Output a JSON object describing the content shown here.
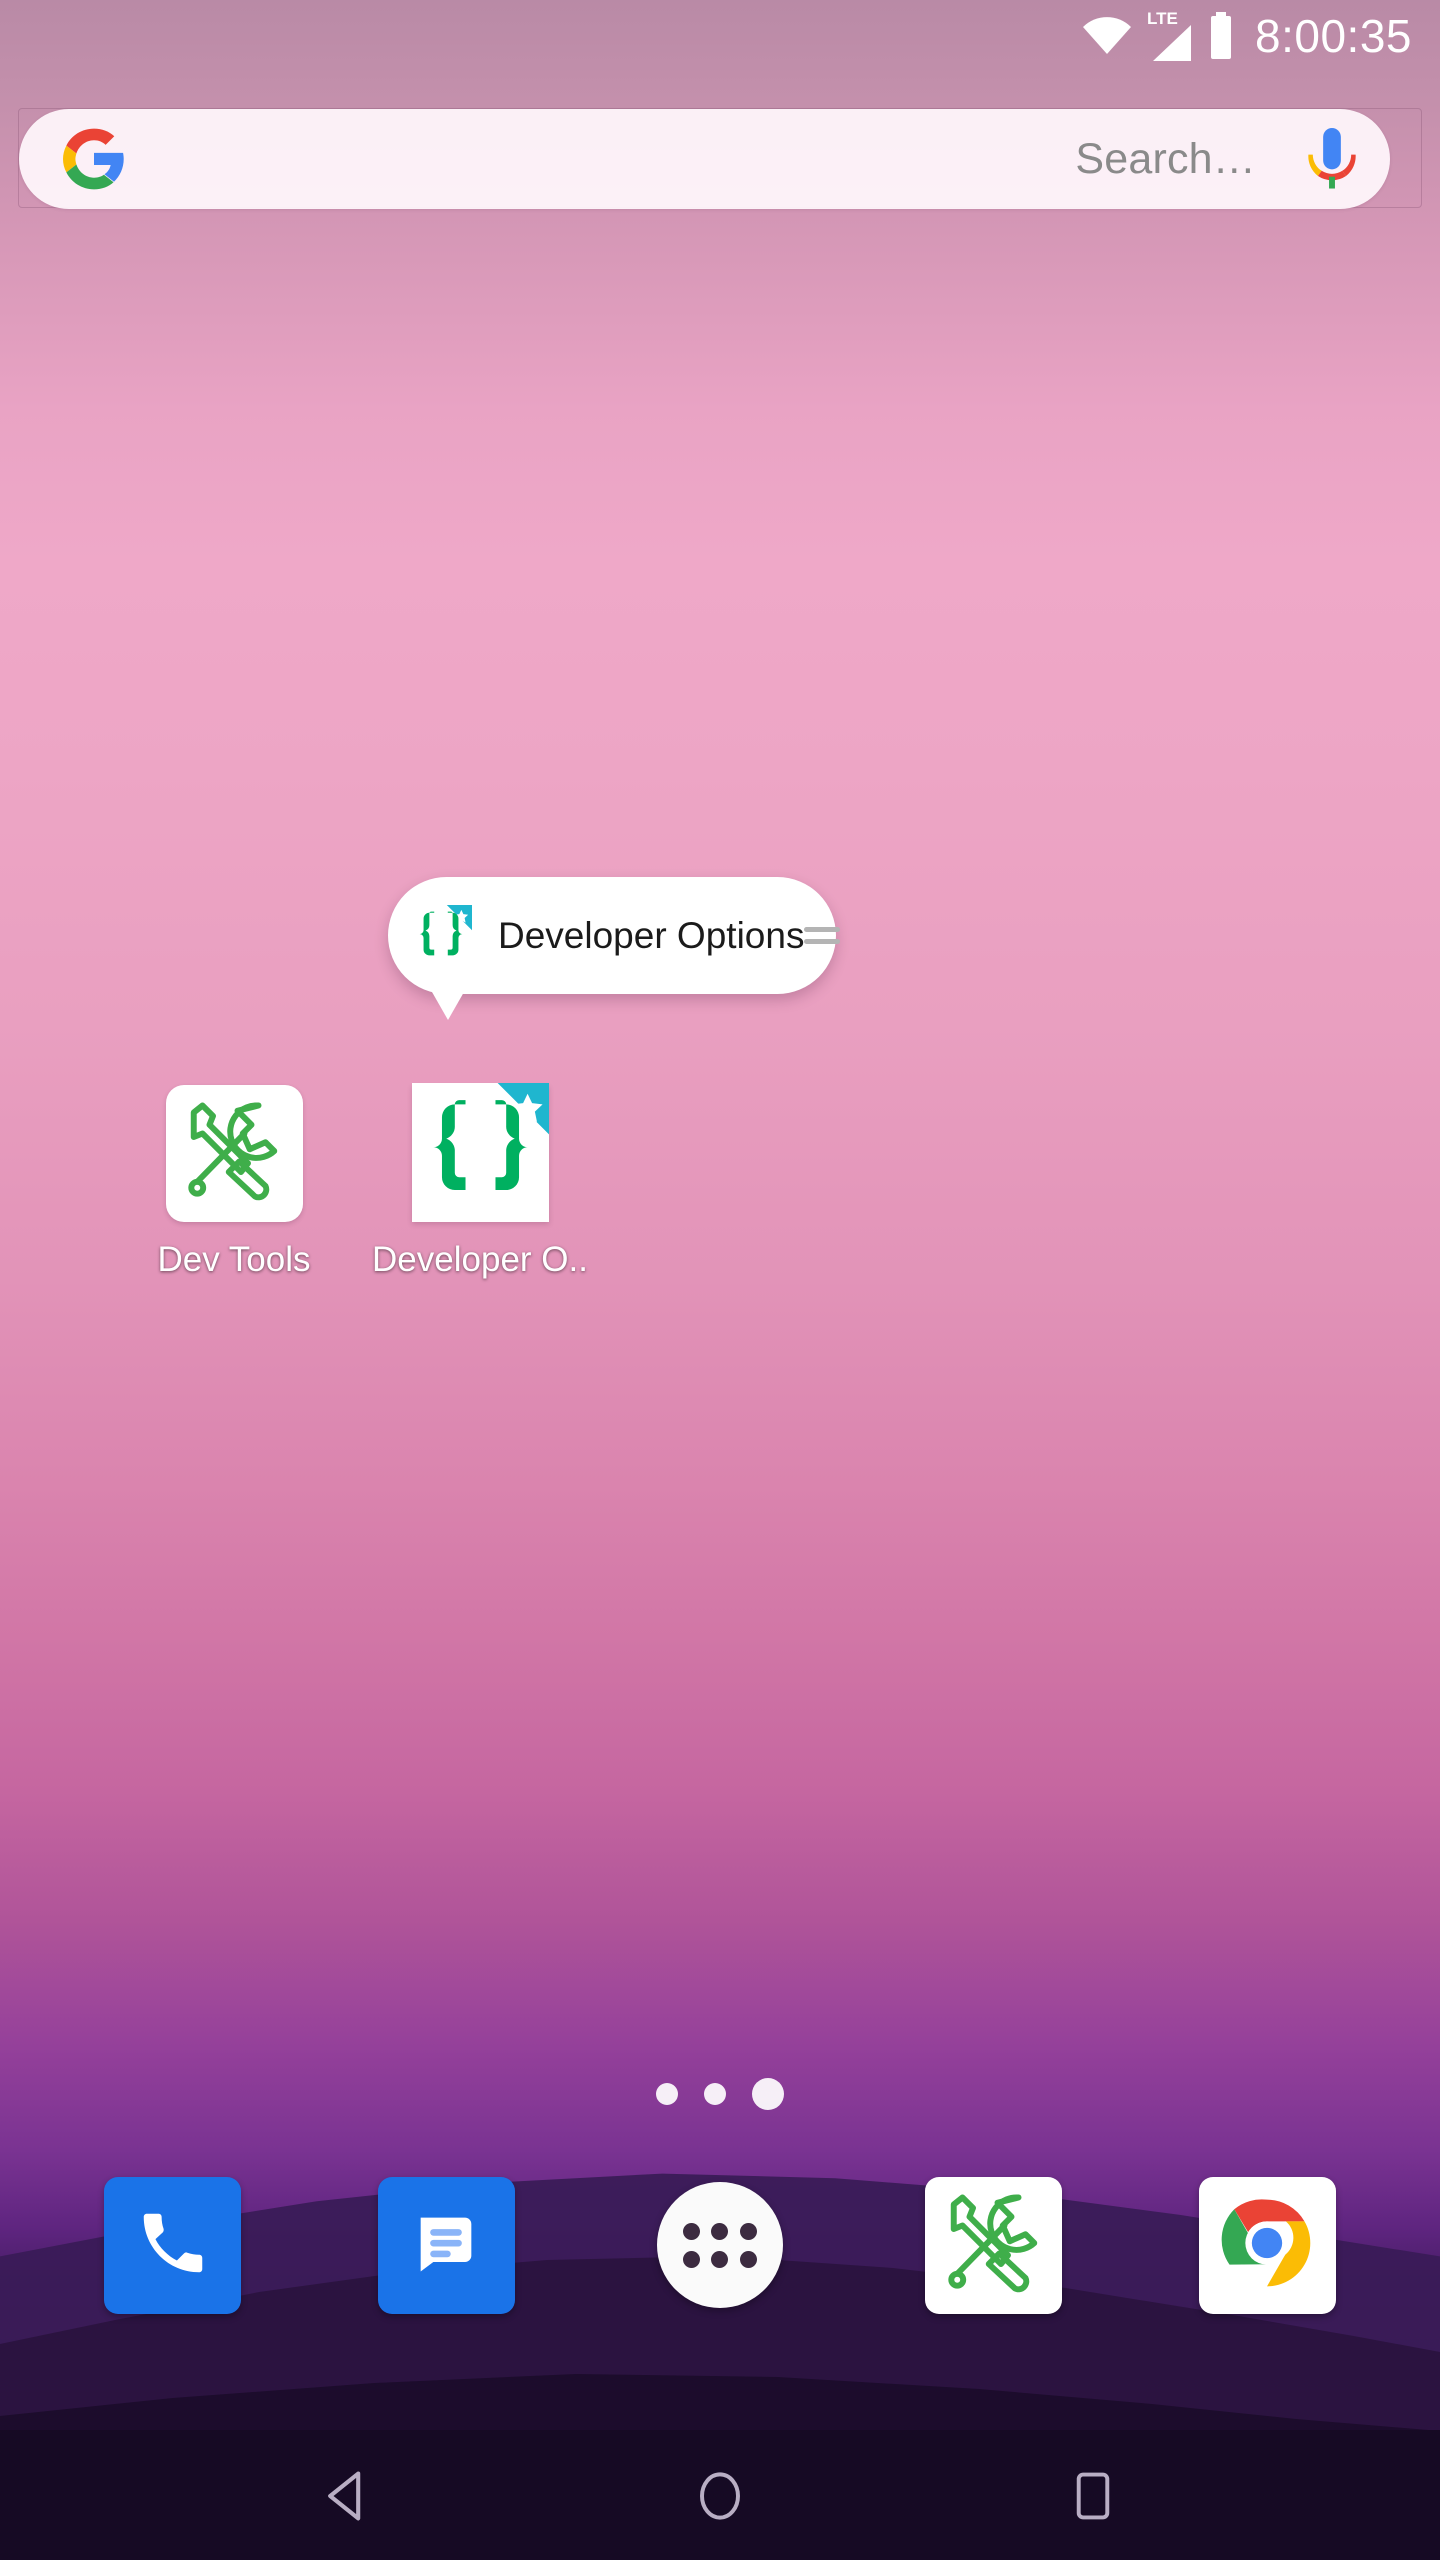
{
  "status_bar": {
    "wifi_icon": "wifi-icon",
    "network_label": "LTE",
    "signal_icon": "cell-signal-icon",
    "battery_icon": "battery-full-icon",
    "clock": "8:00:35"
  },
  "search_widget": {
    "logo_icon": "google-g-icon",
    "placeholder": "Search…",
    "mic_icon": "microphone-icon"
  },
  "popup": {
    "icon": "developer-options-braces-icon",
    "label": "Developer Options",
    "drag_handle_icon": "drag-handle-icon"
  },
  "app_grid": [
    {
      "label": "Dev Tools",
      "icon": "wrench-screwdriver-icon",
      "tile_shape": "rounded"
    },
    {
      "label": "Developer O..",
      "icon": "developer-options-braces-icon",
      "tile_shape": "square"
    }
  ],
  "page_indicator": {
    "count": 3,
    "active_index": 2
  },
  "dock": [
    {
      "label": "Phone",
      "icon": "phone-icon"
    },
    {
      "label": "Messages",
      "icon": "messages-icon"
    },
    {
      "label": "All apps",
      "icon": "app-drawer-icon"
    },
    {
      "label": "Dev Tools",
      "icon": "wrench-screwdriver-icon"
    },
    {
      "label": "Chrome",
      "icon": "chrome-icon"
    }
  ],
  "nav_bar": [
    {
      "label": "Back",
      "icon": "back-triangle-icon"
    },
    {
      "label": "Home",
      "icon": "home-circle-icon"
    },
    {
      "label": "Recents",
      "icon": "recents-square-icon"
    }
  ],
  "colors": {
    "accent_green": "#3fae4a",
    "brace_green": "#00b060",
    "badge_teal": "#1fb6cf",
    "dock_blue": "#1a73e8",
    "wallpaper_top": "#b98aa6",
    "wallpaper_mid": "#efa8c8",
    "wallpaper_bottom": "#160a24"
  }
}
